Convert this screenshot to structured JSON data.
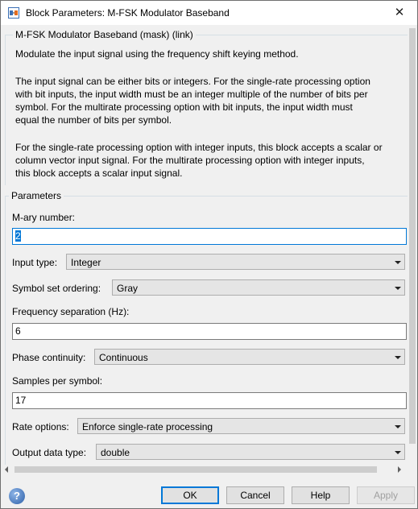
{
  "window": {
    "title": "Block Parameters: M-FSK Modulator Baseband",
    "close_glyph": "✕"
  },
  "description": {
    "group_title": "M-FSK Modulator Baseband (mask) (link)",
    "lines": [
      "Modulate the input signal using the frequency shift keying method.",
      "The input signal can be either bits or integers.  For the single-rate processing option",
      "with bit inputs, the input width must be an integer multiple of the number of bits per",
      "symbol.  For the multirate processing option with bit inputs, the input width must",
      "equal the number of bits per symbol.",
      "For the single-rate processing option with integer inputs, this block accepts a scalar or",
      "column vector input signal.  For the multirate processing option with integer inputs,",
      "this block accepts a scalar input signal."
    ]
  },
  "parameters": {
    "group_title": "Parameters",
    "mary_label": "M-ary number:",
    "mary_value": "2",
    "input_type_label": "Input type:",
    "input_type_value": "Integer",
    "symbol_order_label": "Symbol set ordering:",
    "symbol_order_value": "Gray",
    "freq_sep_label": "Frequency separation (Hz):",
    "freq_sep_value": "6",
    "phase_label": "Phase continuity:",
    "phase_value": "Continuous",
    "samples_label": "Samples per symbol:",
    "samples_value": "17",
    "rate_label": "Rate options:",
    "rate_value": "Enforce single-rate processing",
    "output_label": "Output data type:",
    "output_value": "double"
  },
  "buttons": {
    "ok": "OK",
    "cancel": "Cancel",
    "help": "Help",
    "apply": "Apply",
    "help_icon": "?"
  },
  "icons": {
    "app": "matlab-simulink-icon",
    "help": "help-question-icon"
  },
  "colors": {
    "accent": "#0078d7",
    "selection": "#0078d7"
  }
}
